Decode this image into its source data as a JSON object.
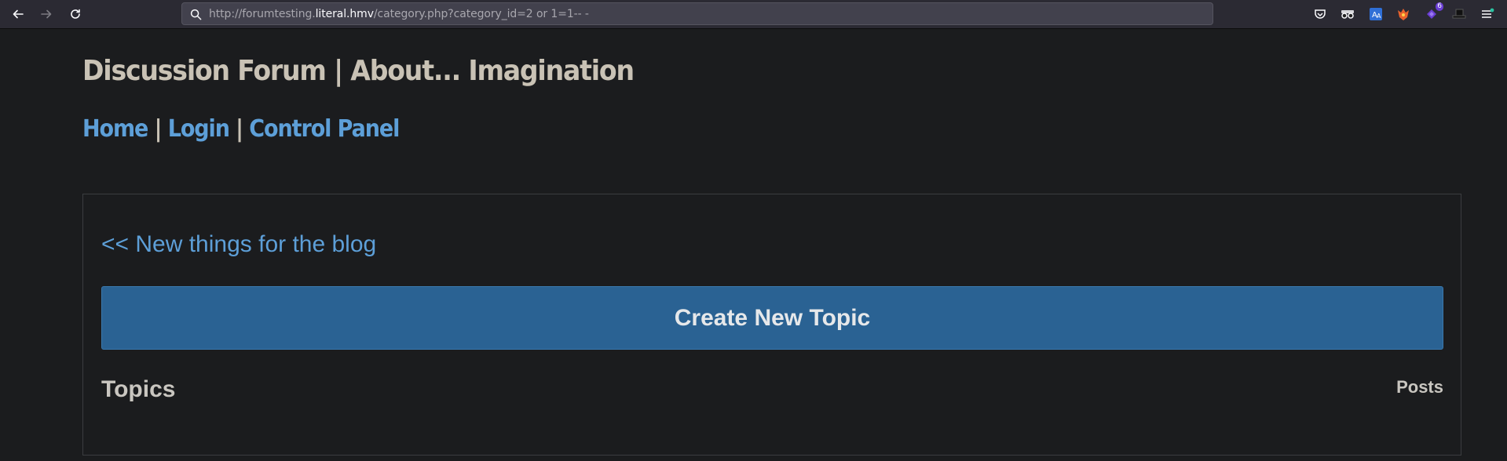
{
  "browser": {
    "url_prefix": "http://forumtesting.",
    "url_host": "literal.hmv",
    "url_suffix": "/category.php?category_id=2 or 1=1-- -",
    "extension_badge": "6"
  },
  "page": {
    "site_title": "Discussion Forum | About... Imagination",
    "nav": {
      "home": "Home",
      "sep1": " | ",
      "login": "Login",
      "sep2": " | ",
      "control_panel": "Control Panel"
    },
    "back_link": "<< New things for the blog",
    "create_button": "Create New Topic",
    "table": {
      "col_topics": "Topics",
      "col_posts": "Posts"
    }
  },
  "colors": {
    "background": "#1b1c1e",
    "link": "#5d9fd8",
    "button": "#2a6293",
    "title": "#c9c2b5"
  }
}
